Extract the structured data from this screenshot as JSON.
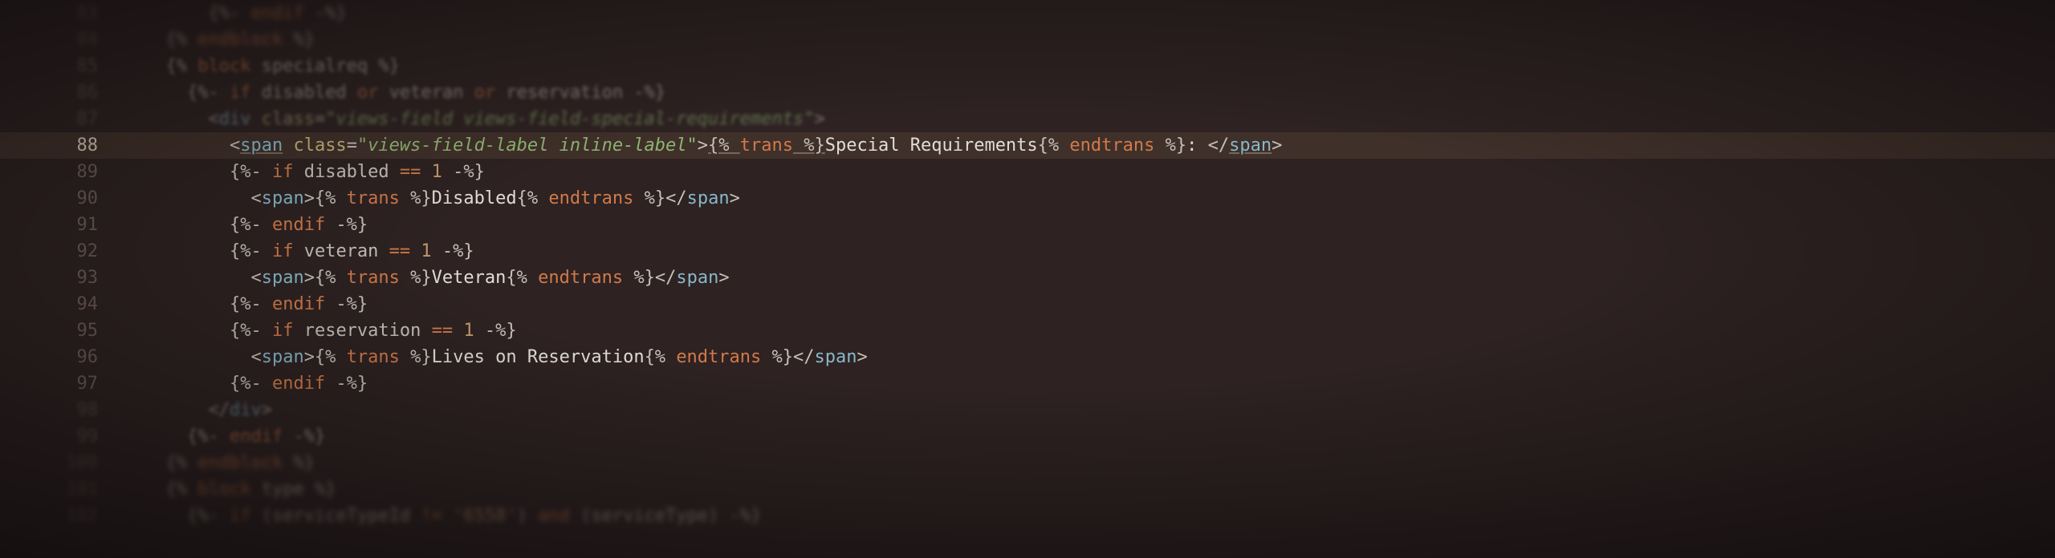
{
  "gutter": [
    "83",
    "84",
    "85",
    "86",
    "87",
    "88",
    "89",
    "90",
    "91",
    "92",
    "93",
    "94",
    "95",
    "96",
    "97",
    "98",
    "99",
    "100",
    "101",
    "102"
  ],
  "currentLine": 5,
  "tokens": {
    "endif": "endif",
    "endblock": "endblock",
    "block": "block",
    "specialreq": "specialreq",
    "if": "if",
    "disabled": "disabled",
    "or": "or",
    "veteran": "veteran",
    "reservation": "reservation",
    "div": "div",
    "span": "span",
    "class": "class",
    "eq": "==",
    "one": "1",
    "trans": "trans",
    "endtrans": "endtrans",
    "type": "type",
    "serviceTypeId": "serviceTypeId",
    "serviceType": "serviceType",
    "and": "and",
    "neq": "!=",
    "val6558": "'6558'"
  },
  "strings": {
    "vf_spec": "\"views-field views-field-special-requirements\"",
    "vf_label": "\"views-field-label inline-label\""
  },
  "text": {
    "specialRequirements": "Special Requirements",
    "colon": ": ",
    "disabled": "Disabled",
    "veteran": "Veteran",
    "livesOnReservation": "Lives on Reservation"
  }
}
